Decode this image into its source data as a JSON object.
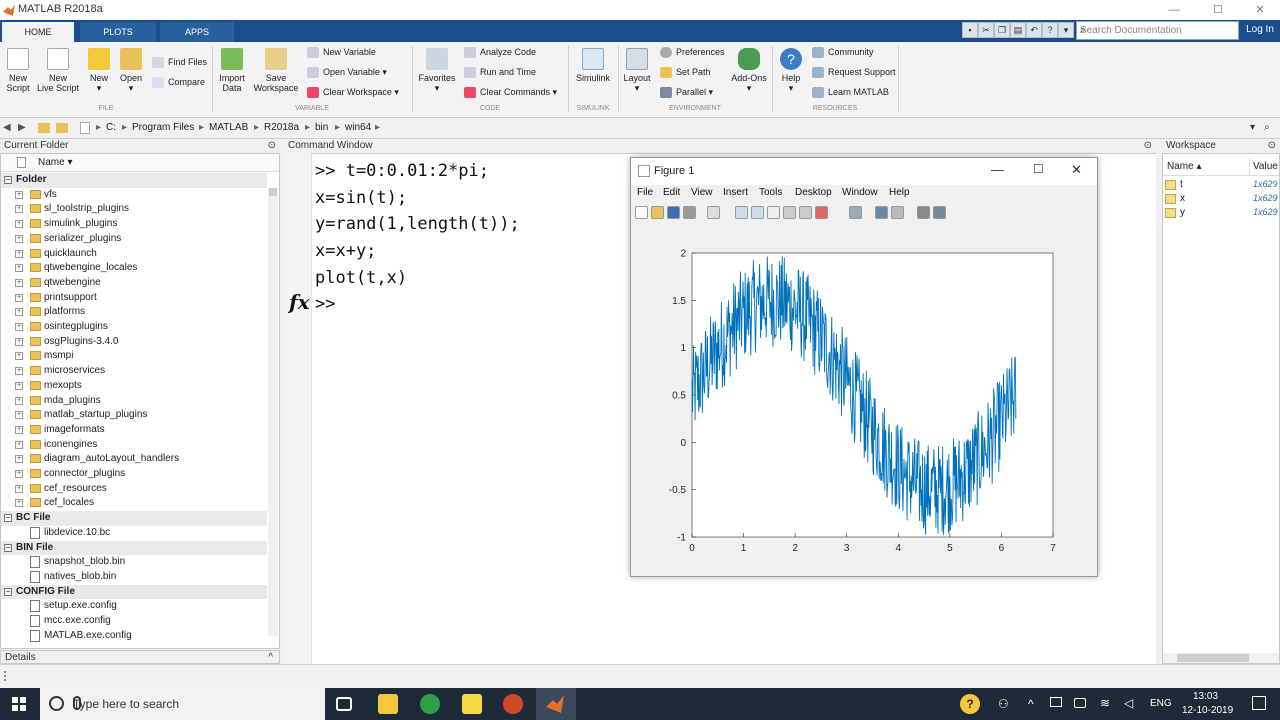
{
  "window": {
    "title": "MATLAB R2018a"
  },
  "tabs": [
    "HOME",
    "PLOTS",
    "APPS"
  ],
  "search": {
    "placeholder": "Search Documentation"
  },
  "login_label": "Log In",
  "ribbon": {
    "file": {
      "label": "FILE",
      "new_script": [
        "New",
        "Script"
      ],
      "new_live_script": [
        "New",
        "Live Script"
      ],
      "new": "New",
      "open": "Open",
      "find_files": "Find Files",
      "compare": "Compare"
    },
    "variable": {
      "label": "VARIABLE",
      "import_data": [
        "Import",
        "Data"
      ],
      "save_workspace": [
        "Save",
        "Workspace"
      ],
      "new_variable": "New Variable",
      "open_variable": "Open Variable",
      "clear_workspace": "Clear Workspace"
    },
    "code": {
      "label": "CODE",
      "favorites": "Favorites",
      "analyze_code": "Analyze Code",
      "run_and_time": "Run and Time",
      "clear_commands": "Clear Commands"
    },
    "simulink": {
      "label": "SIMULINK",
      "simulink": "Simulink"
    },
    "environment": {
      "label": "ENVIRONMENT",
      "layout": "Layout",
      "preferences": "Preferences",
      "set_path": "Set Path",
      "parallel": "Parallel",
      "add_ons": "Add-Ons"
    },
    "resources": {
      "label": "RESOURCES",
      "help": "Help",
      "community": "Community",
      "request_support": "Request Support",
      "learn_matlab": "Learn MATLAB"
    }
  },
  "address": {
    "parts": [
      "C:",
      "Program Files",
      "MATLAB",
      "R2018a",
      "bin",
      "win64"
    ]
  },
  "current_folder": {
    "title": "Current Folder",
    "column": "Name",
    "folder_group": "Folder",
    "folders": [
      "vfs",
      "sl_toolstrip_plugins",
      "simulink_plugins",
      "serializer_plugins",
      "quicklaunch",
      "qtwebengine_locales",
      "qtwebengine",
      "printsupport",
      "platforms",
      "osintegplugins",
      "osgPlugins-3.4.0",
      "msmpi",
      "microservices",
      "mexopts",
      "mda_plugins",
      "matlab_startup_plugins",
      "imageformats",
      "iconengines",
      "diagram_autoLayout_handlers",
      "connector_plugins",
      "cef_resources",
      "cef_locales"
    ],
    "bc_group": "BC File",
    "bc_files": [
      "libdevice.10.bc"
    ],
    "bin_group": "BIN File",
    "bin_files": [
      "snapshot_blob.bin",
      "natives_blob.bin"
    ],
    "config_group": "CONFIG File",
    "config_files": [
      "setup.exe.config",
      "mcc.exe.config",
      "MATLAB.exe.config"
    ],
    "details": "Details"
  },
  "command_window": {
    "title": "Command Window",
    "lines": [
      ">> t=0:0.01:2*pi;",
      "x=sin(t);",
      "y=rand(1,length(t));",
      "x=x+y;",
      "plot(t,x)",
      ">>"
    ],
    "fx": "fx"
  },
  "workspace": {
    "title": "Workspace",
    "col_name": "Name",
    "col_value": "Value",
    "vars": [
      {
        "name": "t",
        "value": "1x629"
      },
      {
        "name": "x",
        "value": "1x629"
      },
      {
        "name": "y",
        "value": "1x629"
      }
    ]
  },
  "figure": {
    "title": "Figure 1",
    "menu": [
      "File",
      "Edit",
      "View",
      "Insert",
      "Tools",
      "Desktop",
      "Window",
      "Help"
    ]
  },
  "chart_data": {
    "type": "line",
    "title": "",
    "xlabel": "",
    "ylabel": "",
    "xlim": [
      0,
      7
    ],
    "ylim": [
      -1,
      2
    ],
    "xticks": [
      "0",
      "1",
      "2",
      "3",
      "4",
      "5",
      "6",
      "7"
    ],
    "yticks": [
      "2",
      "1.5",
      "1",
      "0.5",
      "0",
      "-0.5",
      "-1"
    ],
    "series": [
      {
        "formula": "x = sin(t) + rand(1,length(t)), t = 0:0.01:2*pi",
        "x_start": 0,
        "x_end": 6.28,
        "x_step": 0.01,
        "color": "#0072bd"
      }
    ]
  },
  "taskbar": {
    "search_placeholder": "Type here to search",
    "lang": "ENG",
    "time": "13:03",
    "date": "12-10-2019"
  }
}
